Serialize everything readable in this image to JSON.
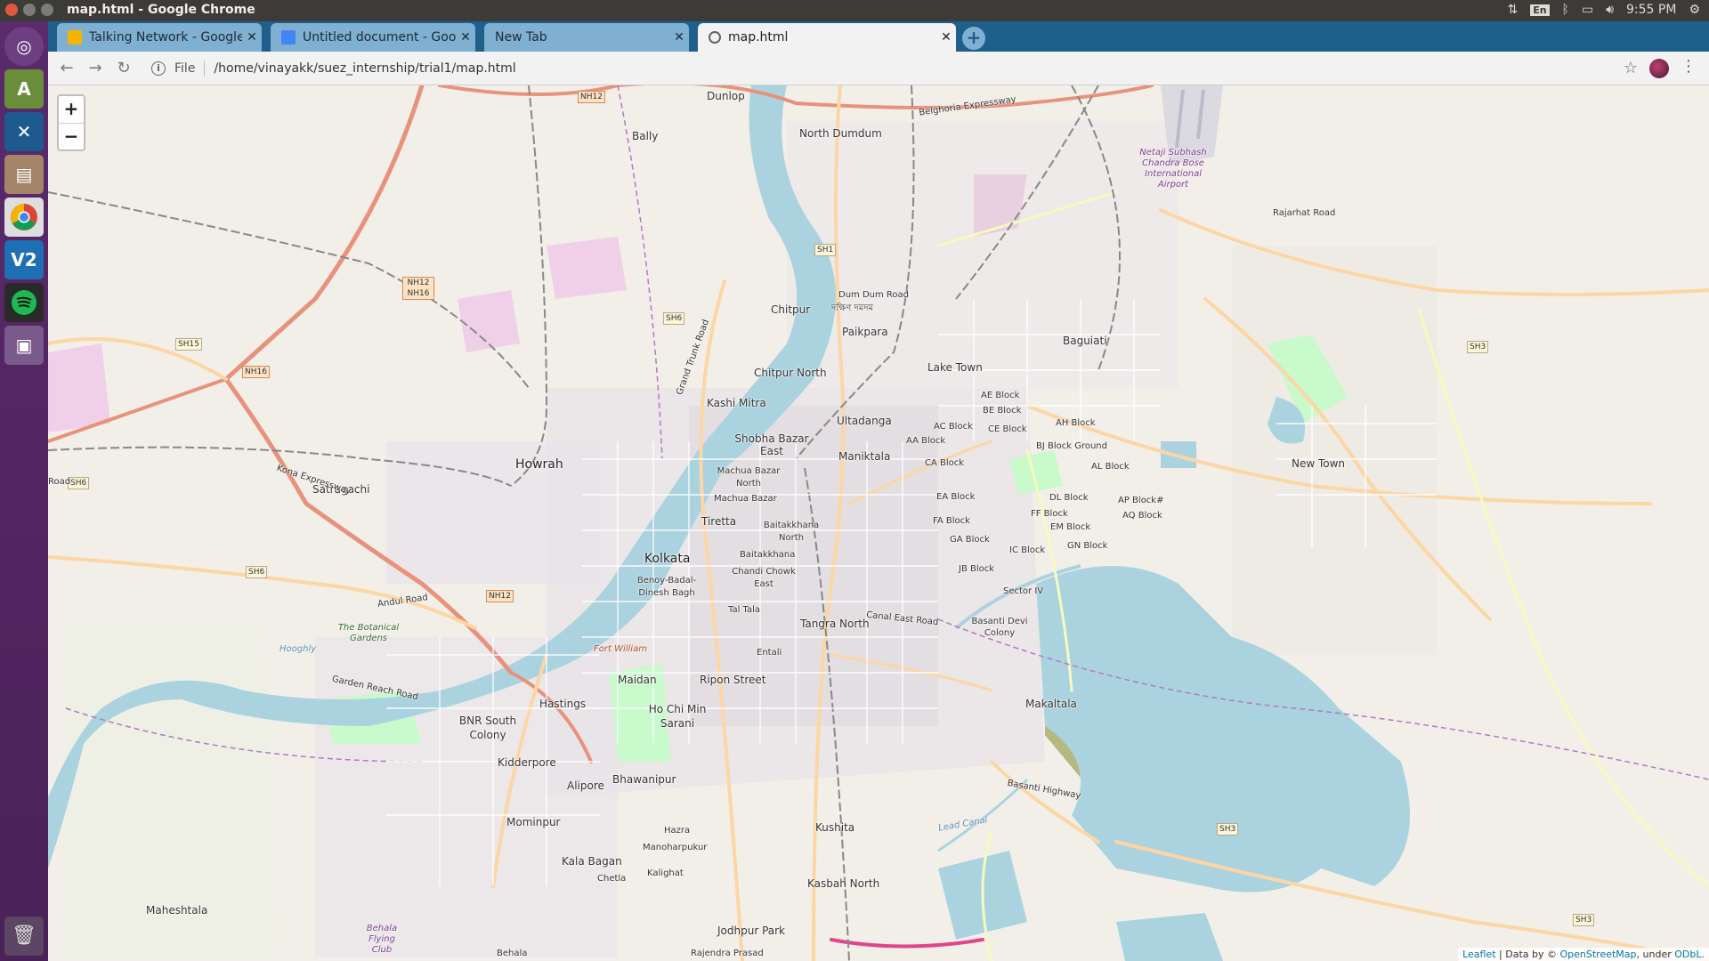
{
  "window": {
    "title": "map.html - Google Chrome"
  },
  "topbar": {
    "lang": "En",
    "time": "9:55 PM"
  },
  "tabs": [
    {
      "label": "Talking Network - Google",
      "favicon_color": "#f4b400"
    },
    {
      "label": "Untitled document - Goog",
      "favicon_color": "#4285f4"
    },
    {
      "label": "New Tab",
      "favicon_color": ""
    },
    {
      "label": "map.html",
      "favicon_color": "#5f6368"
    }
  ],
  "addressbar": {
    "scheme": "File",
    "path": "/home/vinayakk/suez_internship/trial1/map.html"
  },
  "map": {
    "zoom_in": "+",
    "zoom_out": "−",
    "attribution": {
      "leaflet": "Leaflet",
      "data_by": "| Data by ©",
      "osm": "OpenStreetMap",
      "under": ", under",
      "odbl": "ODbL."
    },
    "labels": {
      "dunlop": "Dunlop",
      "bally": "Bally",
      "north_dumdum": "North Dumdum",
      "airport": "Netaji Subhash Chandra Bose International Airport",
      "dum_dum_road": "Dum Dum Road",
      "dakshin_dumdum": "দক্ষিণ দমদম",
      "chitpur": "Chitpur",
      "paikpara": "Paikpara",
      "baguiati": "Baguiati",
      "lake_town": "Lake Town",
      "chitpur_north": "Chitpur North",
      "kashi_mitra": "Kashi Mitra",
      "ultadanga": "Ultadanga",
      "ae_block": "AE Block",
      "be_block": "BE Block",
      "ah_block": "AH Block",
      "ac_block": "AC Block",
      "ce_block": "CE Block",
      "aa_block": "AA Block",
      "shobha_bazar": "Shobha Bazar East",
      "maniktala": "Maniktala",
      "bj_block": "BJ Block Ground",
      "howrah": "Howrah",
      "ca_block": "CA Block",
      "al_block": "AL Block",
      "new_town": "New Town",
      "machua_north": "Machua Bazar North",
      "machua": "Machua Bazar",
      "satragachi": "Satragachi",
      "ea_block": "EA Block",
      "dl_block": "DL Block",
      "ap_block": "AP Block#",
      "aq_block": "AQ Block",
      "ff_block": "FF Block",
      "fa_block": "FA Block",
      "em_block": "EM Block",
      "tiretta": "Tiretta",
      "baitakkhana_north": "Baitakkhana North",
      "ga_block": "GA Block",
      "gn_block": "GN Block",
      "ic_block": "IC Block",
      "kolkata": "Kolkata",
      "baitakkhana": "Baitakkhana",
      "jb_block": "JB Block",
      "chandi_chowk": "Chandi Chowk East",
      "benoy": "Benoy-Badal-Dinesh Bagh",
      "sector_iv": "Sector IV",
      "botanical": "The Botanical Gardens",
      "tal_tala": "Tal Tala",
      "basanti_devi": "Basanti Devi Colony",
      "tangra_north": "Tangra North",
      "fort_william": "Fort William",
      "entali": "Entali",
      "maidan": "Maidan",
      "ripon_street": "Ripon Street",
      "makaltala": "Makaltala",
      "hastings": "Hastings",
      "bnr": "BNR South Colony",
      "ho_chi_min": "Ho Chi Min Sarani",
      "kidderpore": "Kidderpore",
      "alipore": "Alipore",
      "bhawanipur": "Bhawanipur",
      "mominpur": "Mominpur",
      "hazra": "Hazra",
      "kushita": "Kushita",
      "manoharpukur": "Manoharpukur",
      "kala_bagan": "Kala Bagan",
      "kalighat": "Kalighat",
      "chetla": "Chetla",
      "kasbah_north": "Kasbah North",
      "maheshtala": "Maheshtala",
      "behala_flying": "Behala Flying Club",
      "jodhpur_park": "Jodhpur Park",
      "behala": "Behala",
      "rajendra": "Rajendra Prasad",
      "hooghly": "Hooghly",
      "belghoria": "Belghoria Expressway",
      "rajarhat": "Rajarhat Road",
      "basanti_hwy": "Basanti Highway",
      "canal_east": "Canal East Road",
      "garden_reach": "Garden Reach Road",
      "andul_road": "Andul Road",
      "kona_exp": "Kona Expressway",
      "grand_trunk": "Grand Trunk Road",
      "lead_canal": "Lead Canal"
    },
    "shields": {
      "nh12_top": "NH12",
      "sh1": "SH1",
      "nh12_nh16": "NH12 NH16",
      "sh6_a": "SH6",
      "sh15": "SH15",
      "nh16": "NH16",
      "sh3_a": "SH3",
      "sh6_b": "SH6",
      "sh6_c": "SH6",
      "nh12_b": "NH12",
      "sh3_b": "SH3",
      "sh3_c": "SH3",
      "road_left": "Road"
    }
  }
}
